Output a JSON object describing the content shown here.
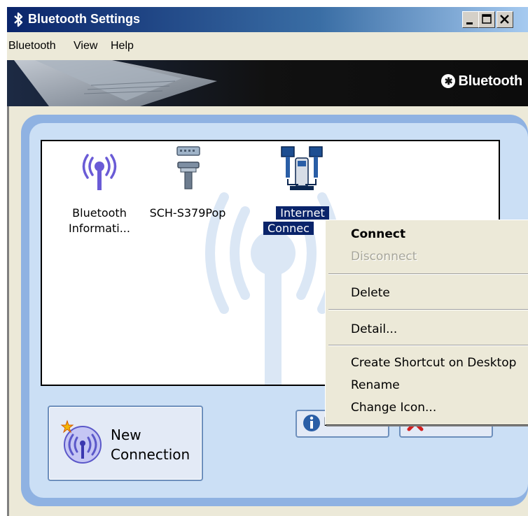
{
  "window": {
    "title": "Bluetooth Settings",
    "controls": {
      "minimize": "_",
      "maximize": "□",
      "close": "×"
    }
  },
  "menubar": {
    "items": [
      "Bluetooth",
      "View",
      "Help"
    ]
  },
  "banner": {
    "logo_text": "Bluetooth",
    "logo_icon": "bluetooth-logo-icon"
  },
  "devices": [
    {
      "label_line1": "Bluetooth",
      "label_line2": "Informati...",
      "icon": "antenna-signal-icon",
      "selected": false
    },
    {
      "label_line1": "SCH-S379Pop",
      "label_line2": "",
      "icon": "phone-connector-icon",
      "selected": false
    },
    {
      "label_line1": "Internet",
      "label_line2": "Connec",
      "icon": "network-computers-icon",
      "selected": true
    }
  ],
  "buttons": {
    "new_connection_line1": "New",
    "new_connection_line2": "Connection",
    "detail": "Detail...",
    "delete": "Delete"
  },
  "context_menu": {
    "items": [
      {
        "label": "Connect",
        "bold": true,
        "disabled": false
      },
      {
        "label": "Disconnect",
        "bold": false,
        "disabled": true
      },
      {
        "label": "Delete",
        "bold": false,
        "disabled": false
      },
      {
        "label": "Detail...",
        "bold": false,
        "disabled": false
      },
      {
        "label": "Create Shortcut on Desktop",
        "bold": false,
        "disabled": false
      },
      {
        "label": "Rename",
        "bold": false,
        "disabled": false
      },
      {
        "label": "Change Icon...",
        "bold": false,
        "disabled": false
      }
    ]
  },
  "colors": {
    "title_bar": "#0a246a",
    "panel_border": "#8fb2e2",
    "panel_fill": "#cbdff5",
    "selection": "#0a246a"
  }
}
